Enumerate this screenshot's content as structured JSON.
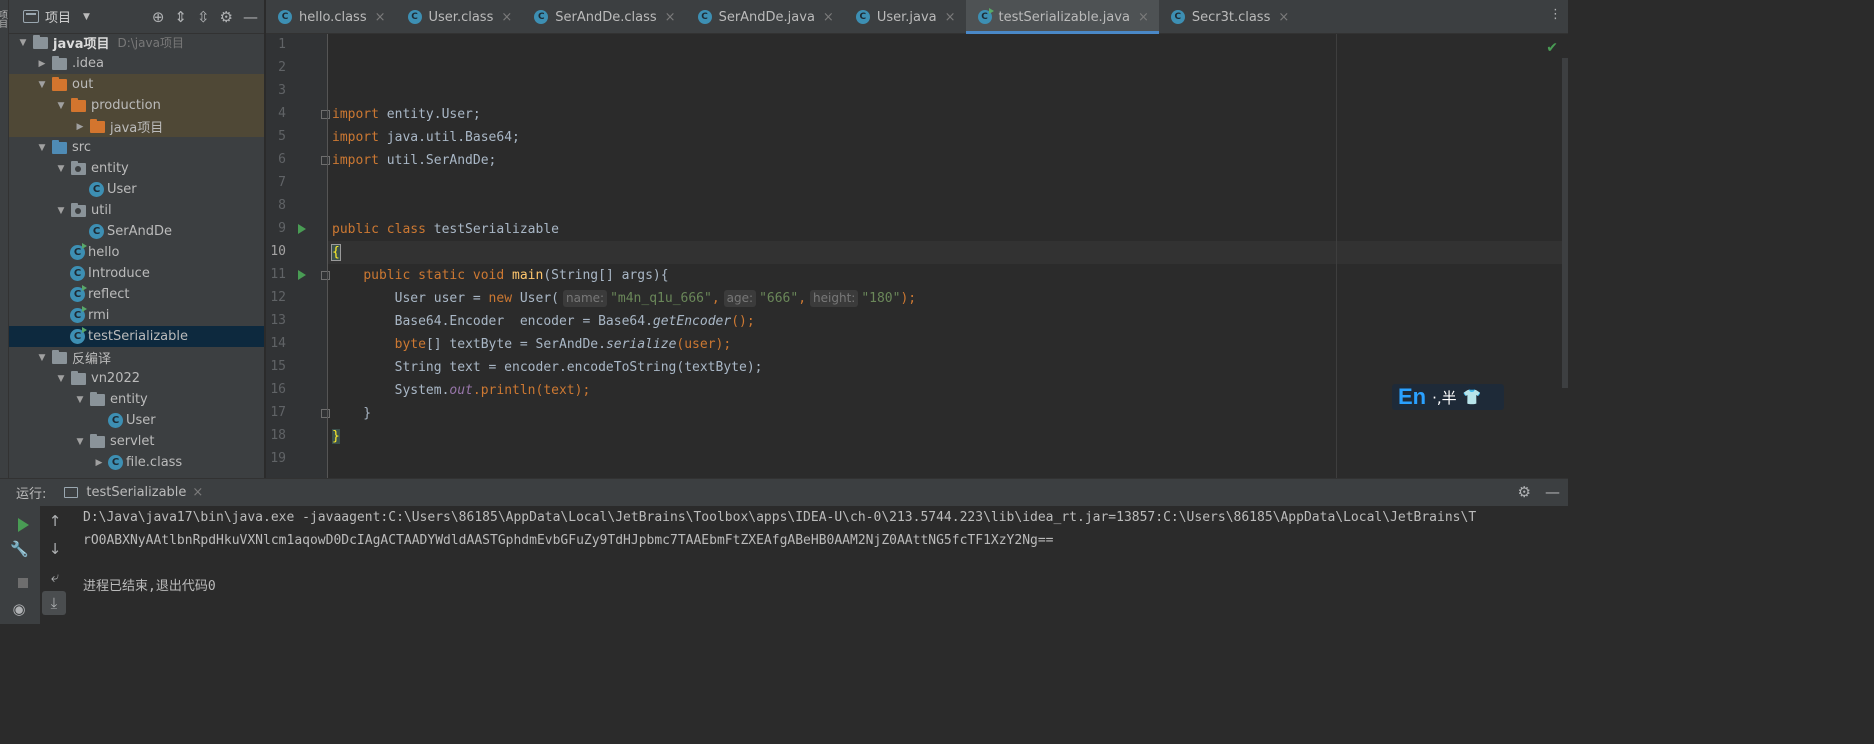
{
  "left_strip": {
    "label": "项目"
  },
  "project_panel": {
    "title": "项目",
    "tree": [
      {
        "label": "java项目",
        "hint": "D:\\java项目",
        "depth": 0,
        "caret": "down",
        "icon": "folder-grey"
      },
      {
        "label": ".idea",
        "depth": 1,
        "caret": "right",
        "icon": "folder-grey"
      },
      {
        "label": "out",
        "depth": 1,
        "caret": "down",
        "icon": "folder-orange"
      },
      {
        "label": "production",
        "depth": 2,
        "caret": "down",
        "icon": "folder-orange"
      },
      {
        "label": "java项目",
        "depth": 3,
        "caret": "right",
        "icon": "folder-orange"
      },
      {
        "label": "src",
        "depth": 1,
        "caret": "down",
        "icon": "folder-blue"
      },
      {
        "label": "entity",
        "depth": 2,
        "caret": "down",
        "icon": "package"
      },
      {
        "label": "User",
        "depth": 3,
        "caret": "none",
        "icon": "class"
      },
      {
        "label": "util",
        "depth": 2,
        "caret": "down",
        "icon": "package"
      },
      {
        "label": "SerAndDe",
        "depth": 3,
        "caret": "none",
        "icon": "class"
      },
      {
        "label": "hello",
        "depth": 2,
        "caret": "none",
        "icon": "class-run"
      },
      {
        "label": "Introduce",
        "depth": 2,
        "caret": "none",
        "icon": "class"
      },
      {
        "label": "reflect",
        "depth": 2,
        "caret": "none",
        "icon": "class-run"
      },
      {
        "label": "rmi",
        "depth": 2,
        "caret": "none",
        "icon": "class-run"
      },
      {
        "label": "testSerializable",
        "depth": 2,
        "caret": "none",
        "icon": "class-run",
        "selected": true
      },
      {
        "label": "反编译",
        "depth": 1,
        "caret": "down",
        "icon": "folder-grey"
      },
      {
        "label": "vn2022",
        "depth": 2,
        "caret": "down",
        "icon": "folder-grey"
      },
      {
        "label": "entity",
        "depth": 3,
        "caret": "down",
        "icon": "folder-grey"
      },
      {
        "label": "User",
        "depth": 4,
        "caret": "none",
        "icon": "class"
      },
      {
        "label": "servlet",
        "depth": 3,
        "caret": "down",
        "icon": "folder-grey"
      },
      {
        "label": "file.class",
        "depth": 4,
        "caret": "right",
        "icon": "class"
      }
    ]
  },
  "tabs": [
    {
      "label": "hello.class",
      "active": false
    },
    {
      "label": "User.class",
      "active": false
    },
    {
      "label": "SerAndDe.class",
      "active": false
    },
    {
      "label": "SerAndDe.java",
      "active": false
    },
    {
      "label": "User.java",
      "active": false
    },
    {
      "label": "testSerializable.java",
      "active": true
    },
    {
      "label": "Secr3t.class",
      "active": false
    }
  ],
  "editor": {
    "line_numbers": [
      "1",
      "2",
      "3",
      "4",
      "5",
      "6",
      "7",
      "8",
      "9",
      "10",
      "11",
      "12",
      "13",
      "14",
      "15",
      "16",
      "17",
      "18",
      "19"
    ],
    "current_line": "10",
    "code": {
      "l4_kw": "import",
      "l4_rest": " entity.User;",
      "l5_kw": "import",
      "l5_rest": " java.util.Base64;",
      "l6_kw": "import",
      "l6_rest": " util.SerAndDe;",
      "l9_kw": "public class",
      "l9_rest": " testSerializable",
      "l10_brace": "{",
      "l11_indent": "    ",
      "l11_kw": "public static void",
      "l11_sp": " ",
      "l11_fn": "main",
      "l11_rest": "(String[] args){",
      "l12_a": "        User user = ",
      "l12_kw": "new",
      "l12_b": " User(",
      "l12_h1": "name:",
      "l12_s1": "\"m4n_q1u_666\"",
      "l12_c1": ",",
      "l12_h2": "age:",
      "l12_s2": "\"666\"",
      "l12_c2": ",",
      "l12_h3": "height:",
      "l12_s3": "\"180\"",
      "l12_end": ");",
      "l13_a": "        Base64.Encoder  encoder = Base64.",
      "l13_it": "getEncoder",
      "l13_b": "();",
      "l14_indent": "        ",
      "l14_kw": "byte",
      "l14_a": "[] textByte = SerAndDe.",
      "l14_it": "serialize",
      "l14_b": "(user);",
      "l15": "        String text = encoder.encodeToString(textByte);",
      "l16_a": "        System.",
      "l16_stat": "out",
      "l16_b": ".println(text);",
      "l17": "    }",
      "l18_brace": "}"
    }
  },
  "ime": {
    "lang": "En",
    "mode": "·,半",
    "skin": "👕"
  },
  "run_panel": {
    "label": "运行:",
    "tab_label": "testSerializable",
    "console": [
      "D:\\Java\\java17\\bin\\java.exe -javaagent:C:\\Users\\86185\\AppData\\Local\\JetBrains\\Toolbox\\apps\\IDEA-U\\ch-0\\213.5744.223\\lib\\idea_rt.jar=13857:C:\\Users\\86185\\AppData\\Local\\JetBrains\\T",
      "rO0ABXNyAAtlbnRpdHkuVXNlcm1aqowD0DcIAgACTAADYWdldAASTGphdmEvbGFuZy9TdHJpbmc7TAAEbmFtZXEAfgABeHB0AAM2NjZ0AAttNG5fcTF1XzY2Ng==",
      "",
      "进程已结束,退出代码0"
    ]
  },
  "colors": {
    "keyword": "#cc7832",
    "string": "#6a8759",
    "function": "#ffc66d",
    "static_field": "#9876aa",
    "active_tab_accent": "#4a88c7",
    "selection": "#0d293e"
  }
}
